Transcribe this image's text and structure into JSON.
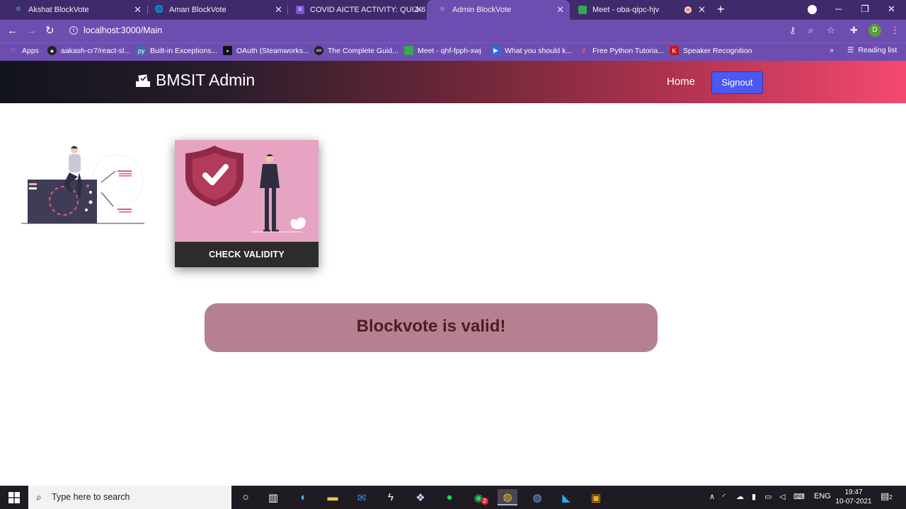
{
  "browser": {
    "tabs": [
      {
        "title": "Akshat BlockVote",
        "active": false
      },
      {
        "title": "Aman BlockVote",
        "active": false
      },
      {
        "title": "COVID AICTE ACTIVITY: QUIZ-6",
        "active": false
      },
      {
        "title": "Admin BlockVote",
        "active": true
      },
      {
        "title": "Meet - oba-qipc-hjv",
        "active": false
      }
    ],
    "url": "localhost:3000/Main",
    "profile_initial": "D",
    "bookmarks": [
      {
        "label": "Apps"
      },
      {
        "label": "aakash-cr7/react-sl..."
      },
      {
        "label": "Built-in Exceptions..."
      },
      {
        "label": "OAuth (Steamworks..."
      },
      {
        "label": "The Complete Guid..."
      },
      {
        "label": "Meet - qhf-fpph-xwj"
      },
      {
        "label": "What you should k..."
      },
      {
        "label": "Free Python Tutoria..."
      },
      {
        "label": "Speaker Recognition"
      }
    ],
    "reading_list": "Reading list"
  },
  "app": {
    "brand": "BMSIT Admin",
    "nav_home": "Home",
    "signout": "Signout",
    "card_button": "CHECK VALIDITY",
    "result_message": "Blockvote is valid!"
  },
  "taskbar": {
    "search_placeholder": "Type here to search",
    "whatsapp_badge": "2",
    "language": "ENG",
    "time": "19:47",
    "date": "10-07-2021",
    "notifications": "2"
  },
  "colors": {
    "tabstrip": "#3f2a6b",
    "toolbar": "#6d4eb0",
    "signout_button": "#4b58f2",
    "card_image_bg": "#e6a4c2",
    "result_bg": "#b58090",
    "result_text": "#4a1d28"
  }
}
